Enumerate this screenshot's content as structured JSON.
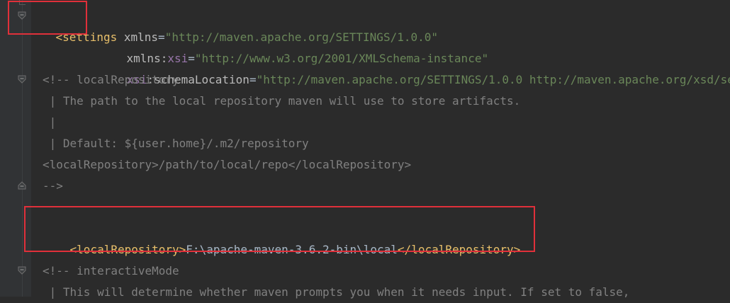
{
  "code": {
    "settings_open": "<settings",
    "xmlns_attr": "xmlns",
    "xmlns_eq": "=",
    "xmlns_value": "\"http://maven.apache.org/SETTINGS/1.0.0\"",
    "xsi_attr_prefix": "xmlns:",
    "xsi_attr_ns": "xsi",
    "xsi_eq": "=",
    "xsi_value": "\"http://www.w3.org/2001/XMLSchema-instance\"",
    "schema_ns": "xsi",
    "schema_attr": ":schemaLocation",
    "schema_eq": "=",
    "schema_value": "\"http://maven.apache.org/SETTINGS/1.0.0 http://maven.apache.org/xsd/se",
    "comment1_open": "<!-- localRepository",
    "comment1_line2": " | The path to the local repository maven will use to store artifacts.",
    "comment1_line3": " |",
    "comment1_line4": " | Default: ${user.home}/.m2/repository",
    "comment1_line5": "<localRepository>/path/to/local/repo</localRepository>",
    "comment1_close": "-->",
    "local_repo_open": "<localRepository>",
    "local_repo_value": "F:\\apache-maven-3.6.2-bin\\local",
    "local_repo_close": "</localRepository>",
    "comment2_open": "<!-- interactiveMode",
    "comment2_line2": " | This will determine whether maven prompts you when it needs input. If set to false,"
  },
  "colors": {
    "background": "#2b2b2b",
    "gutter": "#313335",
    "tag": "#e8bf6a",
    "attribute": "#bababa",
    "namespace": "#9876aa",
    "string": "#6a8759",
    "comment": "#808080",
    "highlight": "#e0303a"
  },
  "icons": [
    "fold-open-icon",
    "fold-close-icon"
  ]
}
